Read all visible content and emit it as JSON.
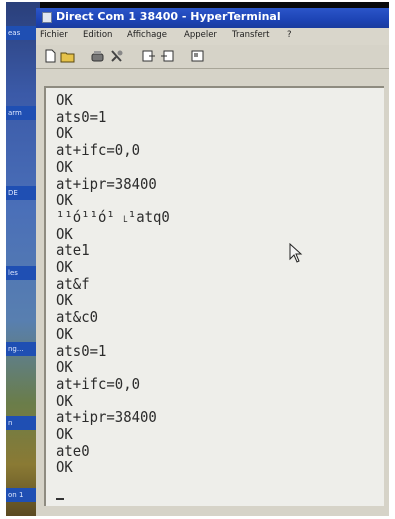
{
  "window": {
    "title": "Direct Com 1 38400 - HyperTerminal"
  },
  "desktop": {
    "labels": [
      {
        "text": "eas"
      },
      {
        "text": "arm"
      },
      {
        "text": "DE"
      },
      {
        "text": "les"
      },
      {
        "text": "ng..."
      },
      {
        "text": "n"
      },
      {
        "text": "on 1"
      }
    ]
  },
  "menu": [
    "Fichier",
    "Edition",
    "Affichage",
    "Appeler",
    "Transfert",
    "?"
  ],
  "toolbar": {
    "buttons": [
      {
        "icon": "new-document-icon"
      },
      {
        "icon": "open-folder-icon"
      },
      {
        "icon": "connect-phone-icon"
      },
      {
        "icon": "disconnect-icon"
      },
      {
        "icon": "send-icon"
      },
      {
        "icon": "receive-icon"
      },
      {
        "icon": "properties-icon"
      }
    ]
  },
  "terminal": {
    "lines": [
      "OK",
      "ats0=1",
      "OK",
      "at+ifc=0,0",
      "OK",
      "at+ipr=38400",
      "OK",
      "¹¹ó¹¹ó¹ ˪¹atq0",
      "OK",
      "ate1",
      "OK",
      "at&f",
      "OK",
      "at&c0",
      "OK",
      "ats0=1",
      "OK",
      "at+ifc=0,0",
      "OK",
      "at+ipr=38400",
      "OK",
      "ate0",
      "OK"
    ]
  }
}
